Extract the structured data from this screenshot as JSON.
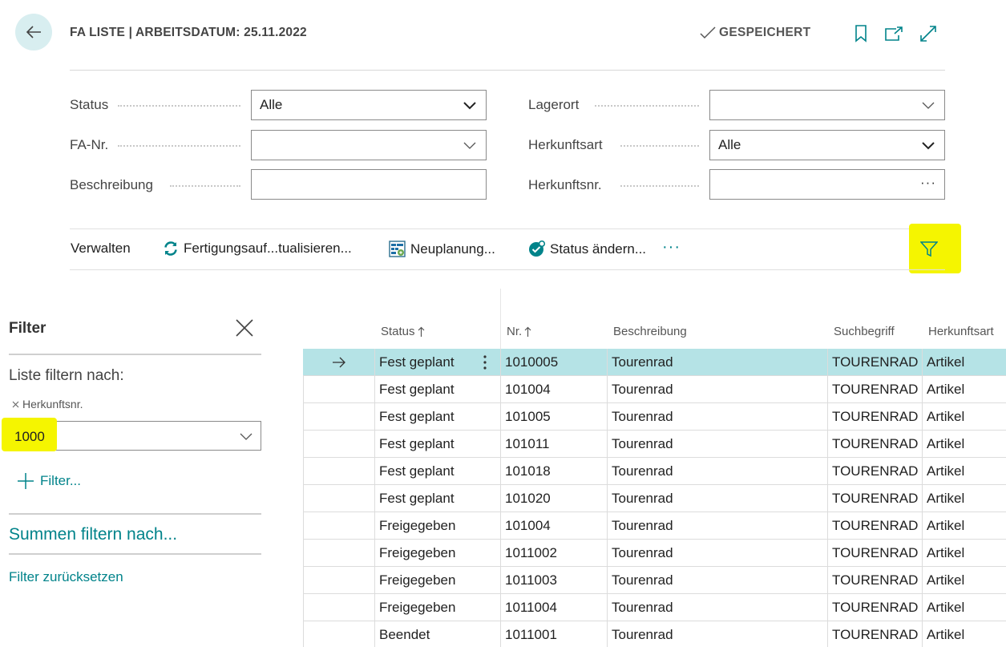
{
  "header": {
    "title": "FA LISTE | ARBEITSDATUM: 25.11.2022",
    "saved_label": "GESPEICHERT",
    "icons": [
      "back-arrow-icon",
      "checkmark-icon",
      "bookmark-icon",
      "open-new-window-icon",
      "expand-icon"
    ]
  },
  "form": {
    "status": {
      "label": "Status",
      "value": "Alle"
    },
    "fa_nr": {
      "label": "FA-Nr.",
      "value": ""
    },
    "beschreibung": {
      "label": "Beschreibung",
      "value": ""
    },
    "lagerort": {
      "label": "Lagerort",
      "value": ""
    },
    "herkunftsart": {
      "label": "Herkunftsart",
      "value": "Alle"
    },
    "herkunftsnr": {
      "label": "Herkunftsnr.",
      "value": "",
      "ellipsis": "···"
    }
  },
  "actions": {
    "manage": "Verwalten",
    "refresh": "Fertigungsauf...tualisieren...",
    "replan": "Neuplanung...",
    "change_status": "Status ändern...",
    "more": "···",
    "highlight_color": "#f5f500",
    "accent_color": "#00838a"
  },
  "filter_pane": {
    "title": "Filter",
    "subtitle": "Liste filtern nach:",
    "chip_label": "Herkunftsnr.",
    "chip_value": "1000",
    "add_filter": "Filter...",
    "sum_filter": "Summen filtern nach...",
    "reset": "Filter zurücksetzen"
  },
  "table": {
    "columns": {
      "status": "Status",
      "nr": "Nr.",
      "beschreibung": "Beschreibung",
      "suchbegriff": "Suchbegriff",
      "herkunftsart": "Herkunftsart"
    },
    "rows": [
      {
        "status": "Fest geplant",
        "nr": "1010005",
        "beschreibung": "Tourenrad",
        "suchbegriff": "TOURENRAD",
        "herkunftsart": "Artikel",
        "selected": true
      },
      {
        "status": "Fest geplant",
        "nr": "101004",
        "beschreibung": "Tourenrad",
        "suchbegriff": "TOURENRAD",
        "herkunftsart": "Artikel"
      },
      {
        "status": "Fest geplant",
        "nr": "101005",
        "beschreibung": "Tourenrad",
        "suchbegriff": "TOURENRAD",
        "herkunftsart": "Artikel"
      },
      {
        "status": "Fest geplant",
        "nr": "101011",
        "beschreibung": "Tourenrad",
        "suchbegriff": "TOURENRAD",
        "herkunftsart": "Artikel"
      },
      {
        "status": "Fest geplant",
        "nr": "101018",
        "beschreibung": "Tourenrad",
        "suchbegriff": "TOURENRAD",
        "herkunftsart": "Artikel"
      },
      {
        "status": "Fest geplant",
        "nr": "101020",
        "beschreibung": "Tourenrad",
        "suchbegriff": "TOURENRAD",
        "herkunftsart": "Artikel"
      },
      {
        "status": "Freigegeben",
        "nr": "101004",
        "beschreibung": "Tourenrad",
        "suchbegriff": "TOURENRAD",
        "herkunftsart": "Artikel"
      },
      {
        "status": "Freigegeben",
        "nr": "1011002",
        "beschreibung": "Tourenrad",
        "suchbegriff": "TOURENRAD",
        "herkunftsart": "Artikel"
      },
      {
        "status": "Freigegeben",
        "nr": "1011003",
        "beschreibung": "Tourenrad",
        "suchbegriff": "TOURENRAD",
        "herkunftsart": "Artikel"
      },
      {
        "status": "Freigegeben",
        "nr": "1011004",
        "beschreibung": "Tourenrad",
        "suchbegriff": "TOURENRAD",
        "herkunftsart": "Artikel"
      },
      {
        "status": "Beendet",
        "nr": "1011001",
        "beschreibung": "Tourenrad",
        "suchbegriff": "TOURENRAD",
        "herkunftsart": "Artikel"
      }
    ]
  }
}
